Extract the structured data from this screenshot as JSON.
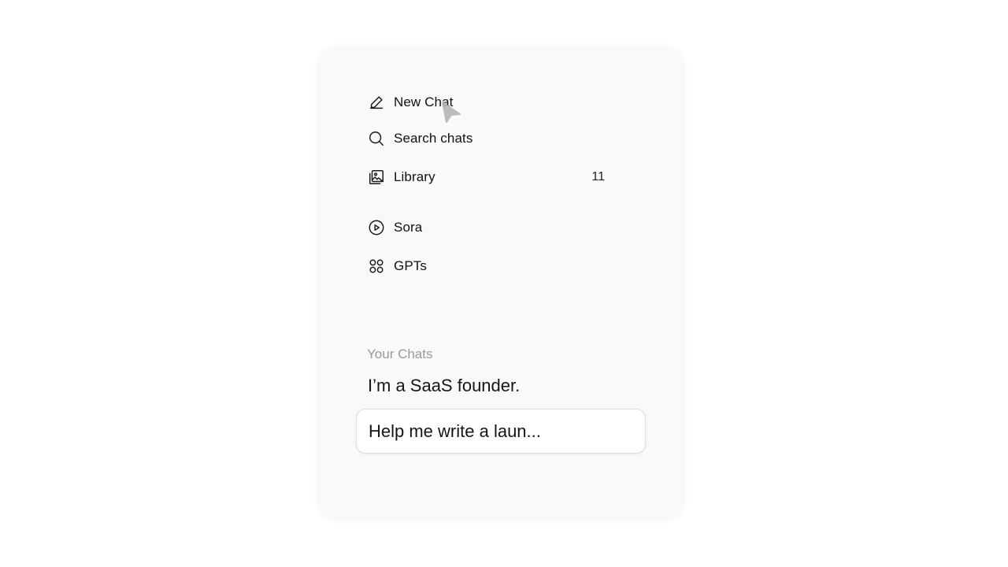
{
  "sidebar": {
    "items": [
      {
        "label": "New Chat",
        "icon": "pencil-edit-icon"
      },
      {
        "label": "Search chats",
        "icon": "search-icon"
      },
      {
        "label": "Library",
        "icon": "image-library-icon",
        "count": "11"
      },
      {
        "label": "Sora",
        "icon": "play-circle-icon"
      },
      {
        "label": "GPTs",
        "icon": "grid-circles-icon"
      }
    ],
    "section_title": "Your Chats",
    "chats": [
      {
        "label": "I’m a SaaS founder."
      },
      {
        "label": "Help me write a laun..."
      }
    ]
  }
}
